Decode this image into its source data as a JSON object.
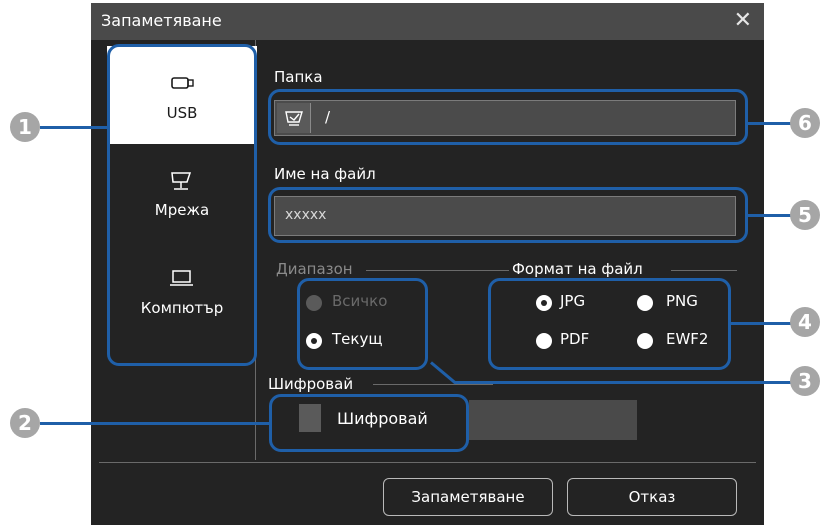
{
  "dialog": {
    "title": "Запаметяване",
    "close_icon": "close-x-icon"
  },
  "sidebar": {
    "items": [
      {
        "label": "USB",
        "icon": "usb-icon",
        "active": true
      },
      {
        "label": "Мрежа",
        "icon": "network-icon",
        "active": false
      },
      {
        "label": "Компютър",
        "icon": "computer-icon",
        "active": false
      }
    ]
  },
  "folder": {
    "label": "Папка",
    "value": "/",
    "browse_icon": "folder-browse-icon"
  },
  "filename": {
    "label": "Име на файл",
    "value": "xxxxx"
  },
  "range": {
    "label": "Диапазон",
    "options": [
      {
        "label": "Всичко",
        "selected": false,
        "disabled": true
      },
      {
        "label": "Текущ",
        "selected": true,
        "disabled": false
      }
    ]
  },
  "format": {
    "label": "Формат на файл",
    "options": [
      {
        "label": "JPG",
        "selected": true
      },
      {
        "label": "PNG",
        "selected": false
      },
      {
        "label": "PDF",
        "selected": false
      },
      {
        "label": "EWF2",
        "selected": false
      }
    ]
  },
  "encrypt": {
    "label": "Шифровай",
    "checkbox_label": "Шифровай",
    "checked": false
  },
  "buttons": {
    "save": "Запаметяване",
    "cancel": "Отказ"
  },
  "callouts": [
    "1",
    "2",
    "3",
    "4",
    "5",
    "6"
  ],
  "colors": {
    "callout": "#1f5fa8",
    "marker": "#a6a6a6",
    "dialog_bg": "#232323",
    "titlebar_bg": "#4a4a4a"
  }
}
